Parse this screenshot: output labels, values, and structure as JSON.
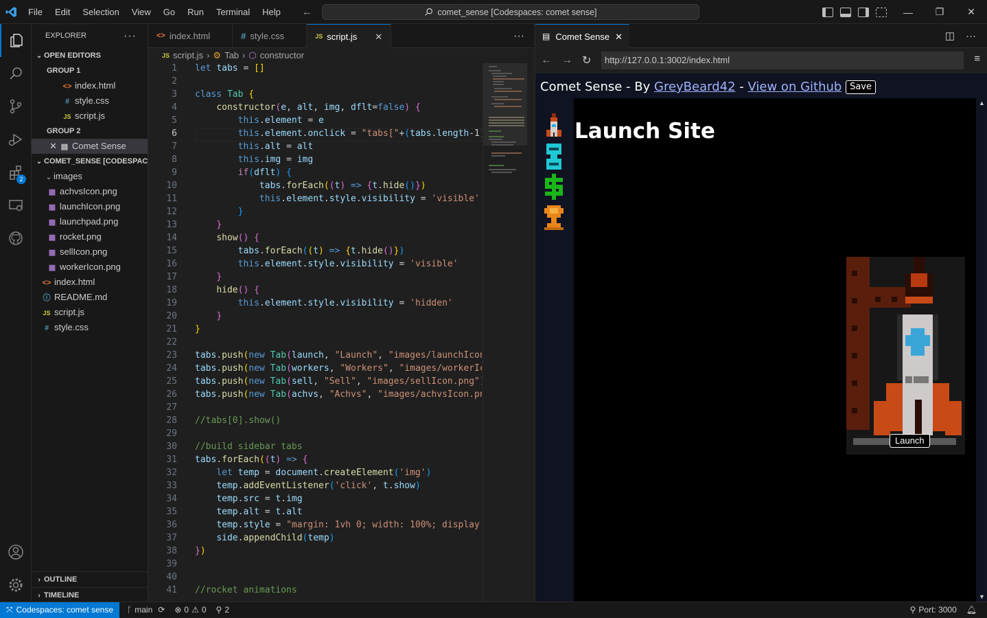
{
  "titlebar": {
    "menu": [
      "File",
      "Edit",
      "Selection",
      "View",
      "Go",
      "Run",
      "Terminal",
      "Help"
    ],
    "search_text": "comet_sense [Codespaces: comet sense]"
  },
  "explorer": {
    "title": "EXPLORER",
    "open_editors": "OPEN EDITORS",
    "group1": "GROUP 1",
    "group1_files": [
      "index.html",
      "style.css",
      "script.js"
    ],
    "group2": "GROUP 2",
    "group2_file": "Comet Sense",
    "workspace": "COMET_SENSE [CODESPAC...",
    "images_folder": "images",
    "images": [
      "achvsIcon.png",
      "launchIcon.png",
      "launchpad.png",
      "rocket.png",
      "sellIcon.png",
      "workerIcon.png"
    ],
    "root_files": [
      "index.html",
      "README.md",
      "script.js",
      "style.css"
    ],
    "outline": "OUTLINE",
    "timeline": "TIMELINE",
    "extensions_badge": "2"
  },
  "editor": {
    "tabs": [
      "index.html",
      "style.css",
      "script.js"
    ],
    "breadcrumb": [
      "script.js",
      "Tab",
      "constructor"
    ],
    "line_numbers": [
      "1",
      "2",
      "3",
      "4",
      "5",
      "6",
      "7",
      "8",
      "9",
      "10",
      "11",
      "12",
      "13",
      "14",
      "15",
      "16",
      "17",
      "18",
      "19",
      "20",
      "21",
      "22",
      "23",
      "24",
      "25",
      "26",
      "27",
      "28",
      "29",
      "30",
      "31",
      "32",
      "33",
      "34",
      "35",
      "36",
      "37",
      "38",
      "39",
      "40",
      "41"
    ]
  },
  "preview": {
    "tab_label": "Comet Sense",
    "url": "http://127.0.0.1:3002/index.html",
    "head_prefix": "Comet Sense - By ",
    "author_link": "GreyBeard42",
    "separator": " - ",
    "github_link": "View on Github",
    "save_label": "Save",
    "site_title": "Launch Site",
    "launch_label": "Launch"
  },
  "statusbar": {
    "remote": "Codespaces: comet sense",
    "branch": "main",
    "errors": "0",
    "warnings": "0",
    "ports_count": "2",
    "port": "Port: 3000"
  }
}
